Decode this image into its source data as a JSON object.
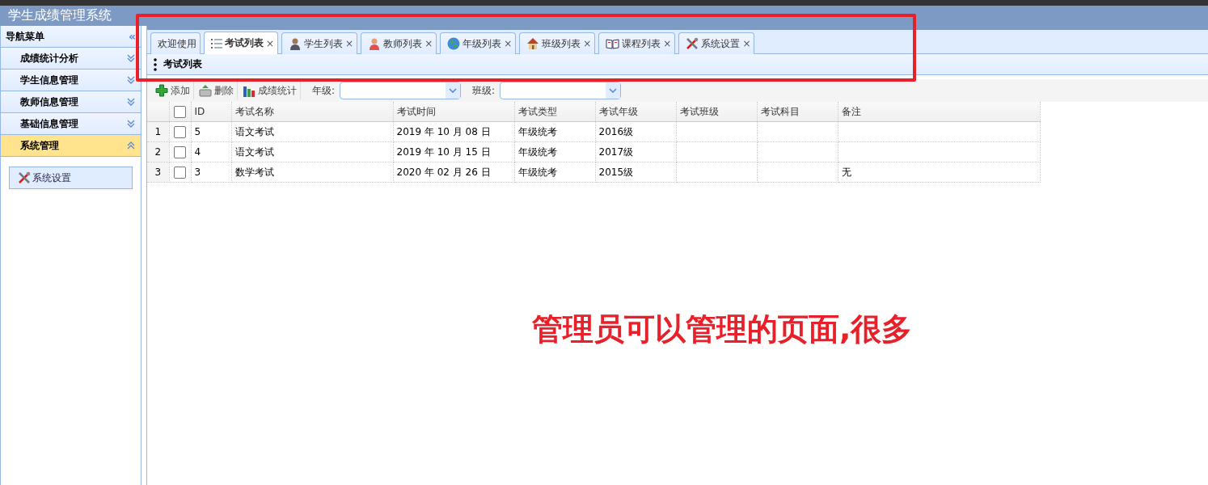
{
  "app_title": "学生成绩管理系统",
  "sidebar": {
    "title": "导航菜单",
    "collapse_glyph": "«",
    "sections": [
      {
        "label": "成绩统计分析",
        "expanded": false
      },
      {
        "label": "学生信息管理",
        "expanded": false
      },
      {
        "label": "教师信息管理",
        "expanded": false
      },
      {
        "label": "基础信息管理",
        "expanded": false
      },
      {
        "label": "系统管理",
        "expanded": true,
        "items": [
          {
            "label": "系统设置",
            "kind": "tools"
          }
        ]
      }
    ]
  },
  "tabs": [
    {
      "label": "欢迎使用",
      "kind": "plain",
      "selected": false
    },
    {
      "label": "考试列表",
      "kind": "list",
      "close": "×",
      "selected": true
    },
    {
      "label": "学生列表",
      "kind": "person",
      "close": "×",
      "selected": false
    },
    {
      "label": "教师列表",
      "kind": "person-red",
      "close": "×",
      "selected": false
    },
    {
      "label": "年级列表",
      "kind": "globe",
      "close": "×",
      "selected": false
    },
    {
      "label": "班级列表",
      "kind": "house",
      "close": "×",
      "selected": false
    },
    {
      "label": "课程列表",
      "kind": "book",
      "close": "×",
      "selected": false
    },
    {
      "label": "系统设置",
      "kind": "tools",
      "close": "×",
      "selected": false
    }
  ],
  "panel_title": "考试列表",
  "toolbar": {
    "buttons": [
      {
        "label": "添加",
        "kind": "plus"
      },
      {
        "label": "删除",
        "kind": "basket"
      },
      {
        "label": "成绩统计",
        "kind": "bars"
      }
    ],
    "filters": [
      {
        "label": "年级:"
      },
      {
        "label": "班级:"
      }
    ]
  },
  "table": {
    "select_all_checked": false,
    "columns": [
      "ID",
      "考试名称",
      "考试时间",
      "考试类型",
      "考试年级",
      "考试班级",
      "考试科目",
      "备注"
    ],
    "rows": [
      {
        "number": "1",
        "checked": false,
        "cells": [
          "5",
          "语文考试",
          "2019 年 10 月 08 日",
          "年级统考",
          "2016级",
          null,
          null,
          null
        ]
      },
      {
        "number": "2",
        "checked": false,
        "cells": [
          "4",
          "语文考试",
          "2019 年 10 月 15 日",
          "年级统考",
          "2017级",
          null,
          null,
          null
        ]
      },
      {
        "number": "3",
        "checked": false,
        "cells": [
          "3",
          "数学考试",
          "2020 年 02 月 26 日",
          "年级统考",
          "2015级",
          null,
          null,
          "无"
        ]
      }
    ]
  },
  "annotation": {
    "text": "管理员可以管理的页面,很多"
  }
}
